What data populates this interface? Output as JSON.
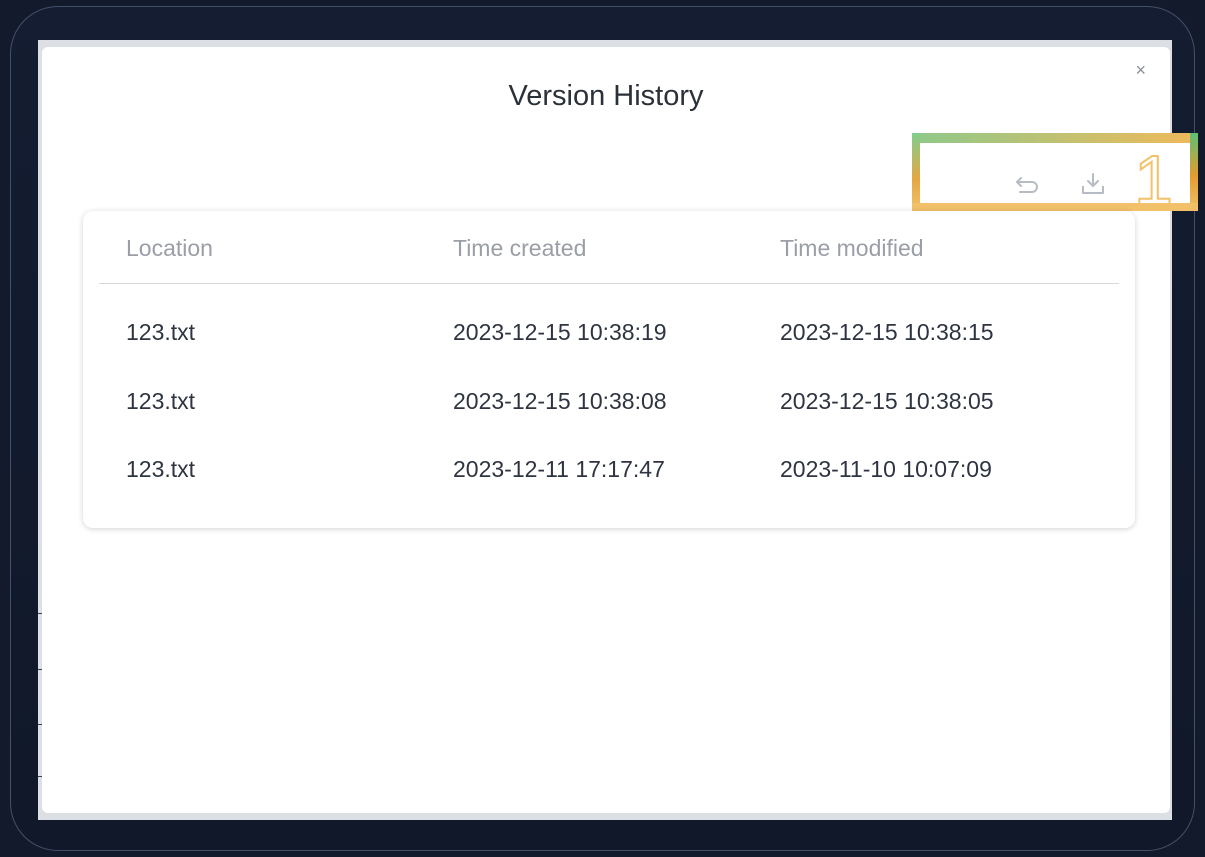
{
  "dialog": {
    "title": "Version History",
    "close_label": "×"
  },
  "toolbar": {
    "restore_icon": "undo-icon",
    "download_icon": "download-icon",
    "annotation_number": "1"
  },
  "table": {
    "columns": [
      "Location",
      "Time created",
      "Time modified"
    ],
    "rows": [
      [
        "123.txt",
        "2023-12-15 10:38:19",
        "2023-12-15 10:38:15"
      ],
      [
        "123.txt",
        "2023-12-15 10:38:08",
        "2023-12-15 10:38:05"
      ],
      [
        "123.txt",
        "2023-12-11 17:17:47",
        "2023-11-10 10:07:09"
      ]
    ]
  },
  "colors": {
    "background": "#121a2c",
    "modal": "#ffffff",
    "annotation": "#f2c26a",
    "annotation_accent": "#7fcf8e"
  }
}
